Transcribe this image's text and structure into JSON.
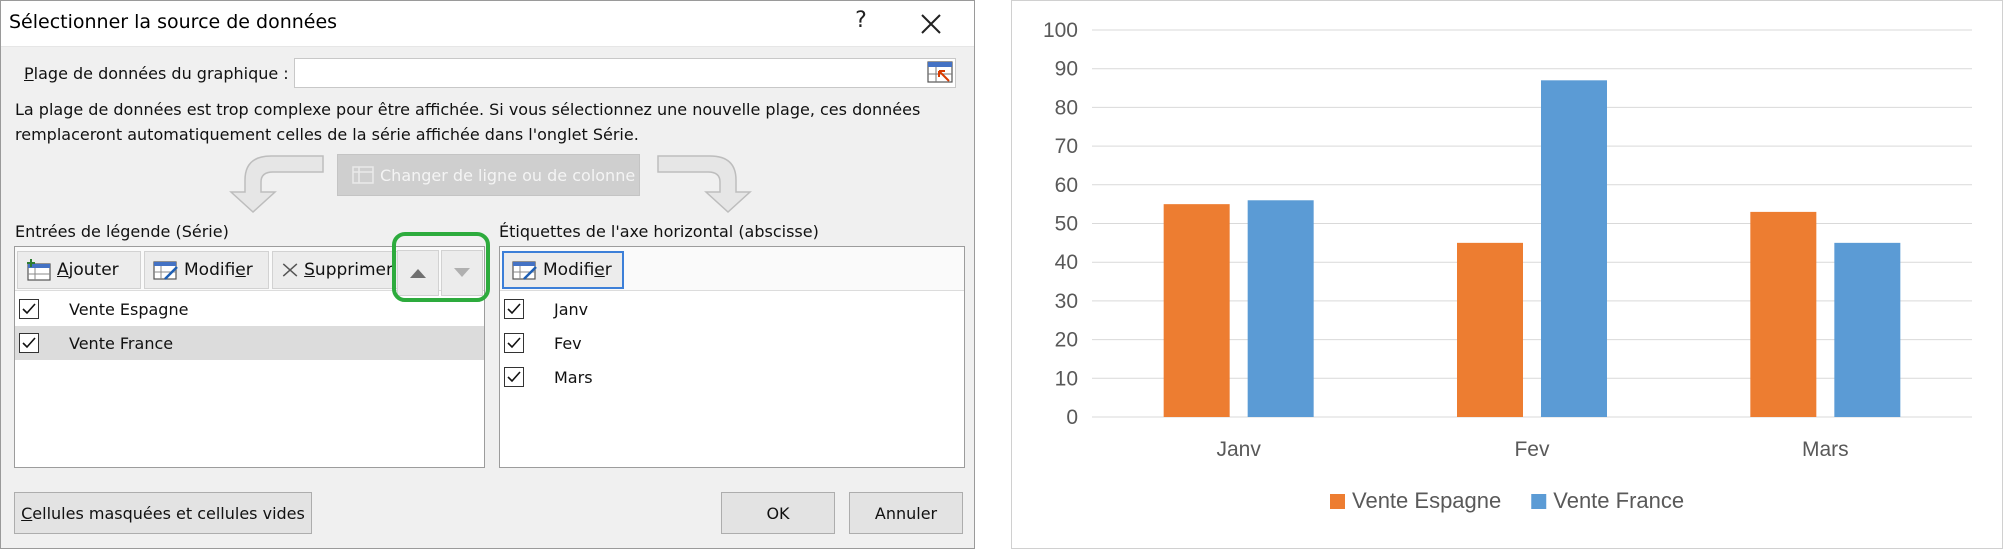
{
  "dialog": {
    "title": "Sélectionner la source de données",
    "help": "?",
    "range_label": "Plage de données du graphique :",
    "info": "La plage de données est trop complexe pour être affichée. Si vous sélectionnez une nouvelle plage, ces données remplaceront automatiquement celles de la série affichée dans l'onglet Série.",
    "switch_label": "Changer de ligne ou de colonne",
    "legend_header": "Entrées de légende (Série)",
    "legend_buttons": {
      "add": "Ajouter",
      "edit": "Modifier",
      "remove": "Supprimer"
    },
    "series": [
      {
        "label": "Vente Espagne",
        "checked": true,
        "selected": false
      },
      {
        "label": "Vente France",
        "checked": true,
        "selected": true
      }
    ],
    "axis_header": "Étiquettes de l'axe horizontal (abscisse)",
    "axis_buttons": {
      "edit": "Modifier"
    },
    "categories": [
      {
        "label": "Janv",
        "checked": true
      },
      {
        "label": "Fev",
        "checked": true
      },
      {
        "label": "Mars",
        "checked": true
      }
    ],
    "hidden_cells": "Cellules masquées et cellules vides",
    "ok": "OK",
    "cancel": "Annuler"
  },
  "chart_data": {
    "type": "bar",
    "categories": [
      "Janv",
      "Fev",
      "Mars"
    ],
    "series": [
      {
        "name": "Vente Espagne",
        "values": [
          55,
          45,
          53
        ],
        "color": "#ed7d31"
      },
      {
        "name": "Vente France",
        "values": [
          56,
          87,
          45
        ],
        "color": "#5b9bd5"
      }
    ],
    "ylim": [
      0,
      100
    ],
    "yticks": [
      0,
      10,
      20,
      30,
      40,
      50,
      60,
      70,
      80,
      90,
      100
    ],
    "grid": true,
    "legend_position": "bottom",
    "title": "",
    "xlabel": "",
    "ylabel": ""
  },
  "colors": {
    "highlight_ring": "#2dab3d",
    "selected_row": "#dcdcdc"
  }
}
